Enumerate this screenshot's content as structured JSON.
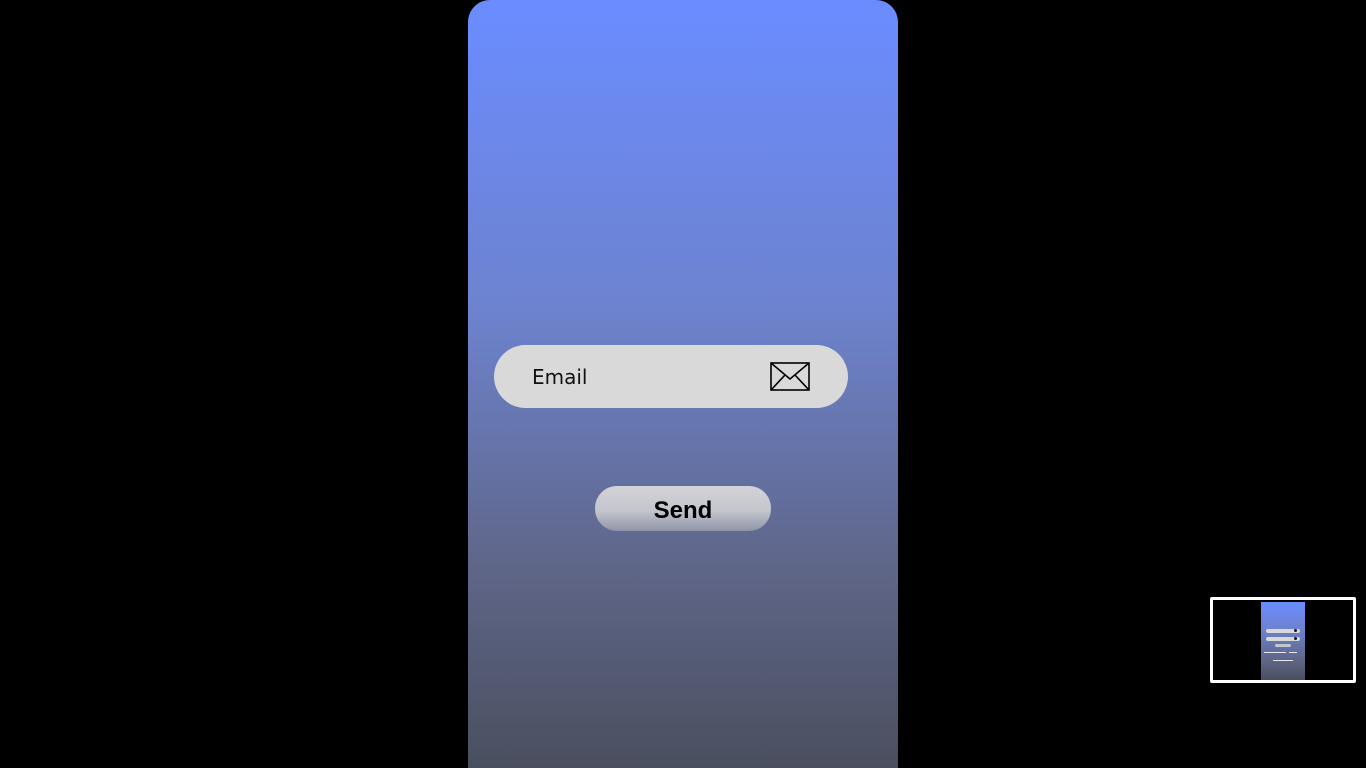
{
  "email_form": {
    "email_placeholder": "Email",
    "email_value": "",
    "send_label": "Send"
  },
  "icons": {
    "email_field_icon": "envelope-icon"
  },
  "colors": {
    "background": "#000000",
    "gradient_top": "#6a8cff",
    "gradient_bottom": "#4a4f5f",
    "field_background": "#d9d9d9",
    "button_top": "#d3d3d8",
    "button_bottom": "#8f94a8",
    "minimap_border": "#ffffff"
  }
}
